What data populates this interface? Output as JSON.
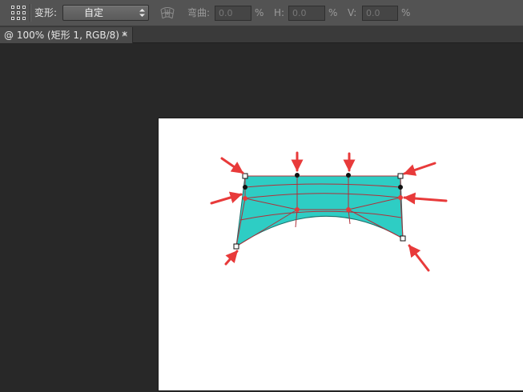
{
  "options_bar": {
    "transform_icon": "grid-transform-icon",
    "transform_label": "变形:",
    "warp_style_value": "自定",
    "warp_icon": "warp-orientation-icon",
    "bend_label": "弯曲:",
    "bend_value": "0.0",
    "bend_unit": "%",
    "h_label": "H:",
    "h_value": "0.0",
    "h_unit": "%",
    "v_label": "V:",
    "v_value": "0.0",
    "v_unit": "%"
  },
  "document_tab": {
    "title": "@ 100% (矩形 1, RGB/8) *",
    "close_label": "×"
  },
  "colors": {
    "app_bg": "#282828",
    "options_bar_bg": "#535353",
    "canvas_bg": "#ffffff",
    "shape_fill": "#2ecdc4",
    "mesh_line": "#b0303a",
    "arrow": "#e83a3a"
  }
}
